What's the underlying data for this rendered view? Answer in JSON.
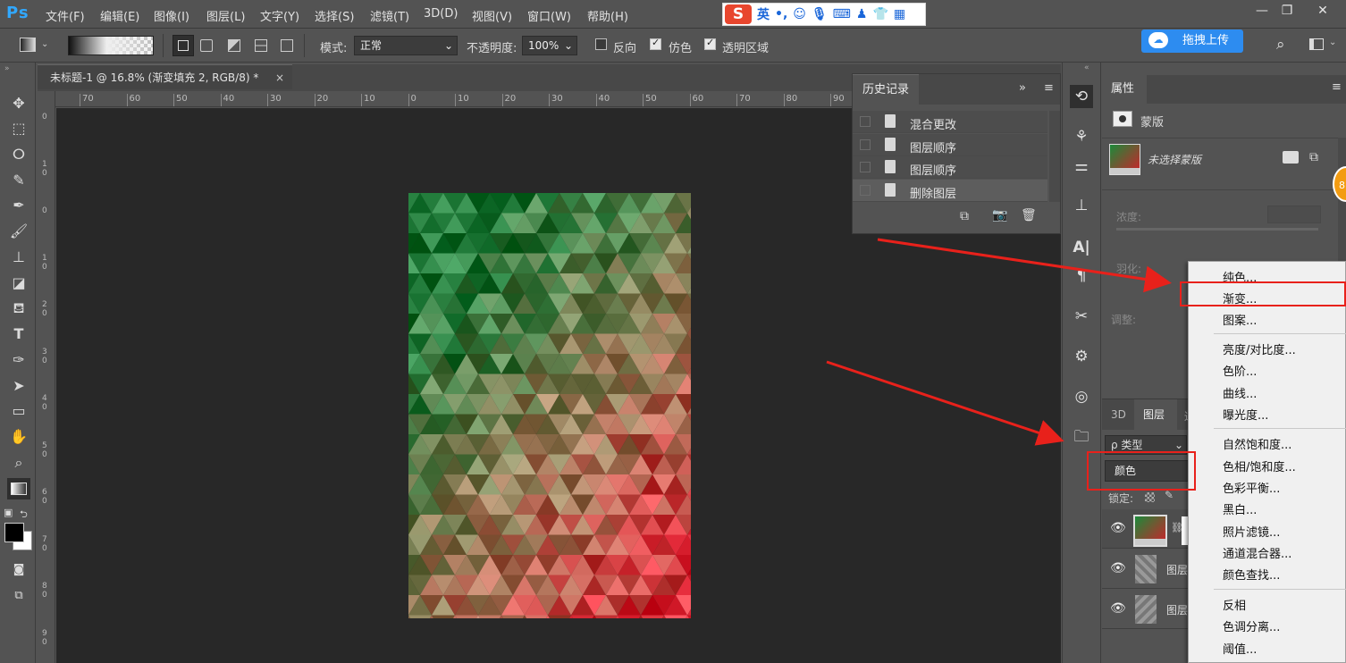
{
  "app": {
    "logo": "Ps"
  },
  "menubar": {
    "items": [
      "文件(F)",
      "编辑(E)",
      "图像(I)",
      "图层(L)",
      "文字(Y)",
      "选择(S)",
      "滤镜(T)",
      "3D(D)",
      "视图(V)",
      "窗口(W)",
      "帮助(H)"
    ]
  },
  "ime": {
    "logo": "S",
    "label": "英",
    "punct": "•,"
  },
  "window_controls": {
    "minimize": "—",
    "restore": "❐",
    "close": "✕"
  },
  "options": {
    "mode_label": "模式:",
    "mode_value": "正常",
    "opacity_label": "不透明度:",
    "opacity_value": "100%",
    "reverse_label": "反向",
    "reverse_checked": false,
    "dither_label": "仿色",
    "dither_checked": true,
    "transparency_label": "透明区域",
    "transparency_checked": true,
    "upload_label": "拖拽上传"
  },
  "document": {
    "tab_title": "未标题-1 @ 16.8% (渐变填充 2, RGB/8) *",
    "close": "×",
    "ruler_h": [
      "70",
      "60",
      "50",
      "40",
      "30",
      "20",
      "10",
      "0",
      "10",
      "20",
      "30",
      "40",
      "50",
      "60",
      "70",
      "80",
      "90"
    ],
    "ruler_v": [
      "0",
      "1\n0",
      "0",
      "1\n0",
      "2\n0",
      "3\n0",
      "4\n0",
      "5\n0",
      "6\n0",
      "7\n0",
      "8\n0",
      "9\n0"
    ]
  },
  "history": {
    "title": "历史记录",
    "collapse": "»",
    "items": [
      "混合更改",
      "图层顺序",
      "图层顺序",
      "删除图层"
    ],
    "selected_index": 3
  },
  "properties": {
    "title": "属性",
    "mask_label": "蒙版",
    "mask_name": "未选择蒙版",
    "density_label": "浓度:",
    "feather_label": "羽化:",
    "adjust_label": "调整:"
  },
  "layers": {
    "tabs": [
      "3D",
      "图层",
      "通"
    ],
    "active_tab": "图层",
    "filter_label": "ρ 类型",
    "filter_value": "颜色",
    "lock_label": "锁定:",
    "rows": [
      "",
      "图层",
      "图层"
    ]
  },
  "context_menu": {
    "groups": [
      [
        "纯色...",
        "渐变...",
        "图案..."
      ],
      [
        "亮度/对比度...",
        "色阶...",
        "曲线...",
        "曝光度..."
      ],
      [
        "自然饱和度...",
        "色相/饱和度...",
        "色彩平衡...",
        "黑白...",
        "照片滤镜...",
        "通道混合器...",
        "颜色查找..."
      ],
      [
        "反相",
        "色调分离...",
        "阈值..."
      ]
    ],
    "highlighted": "渐变..."
  },
  "badge": {
    "text": "8"
  },
  "colors": {
    "accent": "#31a8ff",
    "annotation": "#e8211b",
    "canvas_bg": "#282828",
    "panel": "#535353"
  }
}
